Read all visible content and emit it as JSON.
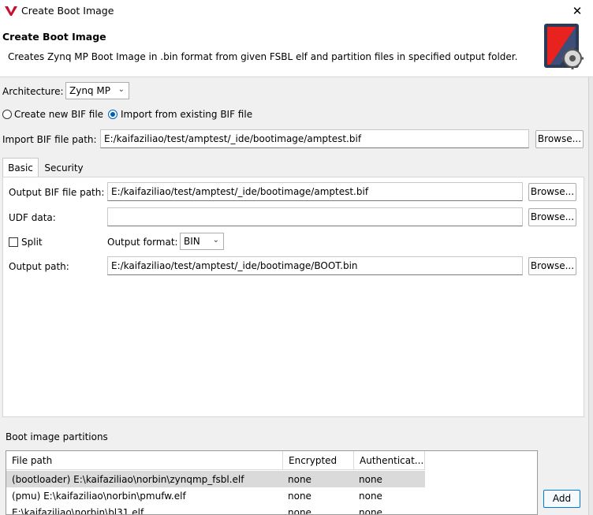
{
  "window": {
    "title": "Create Boot Image",
    "close_icon": "close-icon"
  },
  "header": {
    "title": "Create Boot Image",
    "description": "Creates Zynq MP Boot Image in .bin format from given FSBL elf and partition files in specified output folder."
  },
  "form": {
    "architecture_label": "Architecture:",
    "architecture_value": "Zynq MP",
    "radio_create_label": "Create new BIF file",
    "radio_import_label": "Import from existing BIF file",
    "radio_selected": "import",
    "import_bif_label": "Import BIF file path:",
    "import_bif_value": "E:/kaifaziliao/test/amptest/_ide/bootimage/amptest.bif",
    "browse_label": "Browse..."
  },
  "tabs": [
    {
      "label": "Basic",
      "active": true
    },
    {
      "label": "Security",
      "active": false
    }
  ],
  "basic": {
    "output_bif_label": "Output BIF file path:",
    "output_bif_value": "E:/kaifaziliao/test/amptest/_ide/bootimage/amptest.bif",
    "udf_label": "UDF data:",
    "udf_value": "",
    "split_label": "Split",
    "split_checked": false,
    "output_format_label": "Output format:",
    "output_format_value": "BIN",
    "output_path_label": "Output path:",
    "output_path_value": "E:/kaifaziliao/test/amptest/_ide/bootimage/BOOT.bin"
  },
  "partitions": {
    "section_label": "Boot image partitions",
    "columns": [
      "File path",
      "Encrypted",
      "Authenticat..."
    ],
    "rows": [
      {
        "file_path": "(bootloader) E:\\kaifaziliao\\norbin\\zynqmp_fsbl.elf",
        "encrypted": "none",
        "authenticated": "none",
        "selected": true
      },
      {
        "file_path": "(pmu) E:\\kaifaziliao\\norbin\\pmufw.elf",
        "encrypted": "none",
        "authenticated": "none",
        "selected": false
      },
      {
        "file_path": "E:\\kaifaziliao\\norbin\\bl31.elf",
        "encrypted": "none",
        "authenticated": "none",
        "selected": false
      }
    ],
    "add_label": "Add"
  },
  "colors": {
    "accent": "#005fb8",
    "selection": "#dadada",
    "dialog_bg": "#f0f0f0"
  }
}
